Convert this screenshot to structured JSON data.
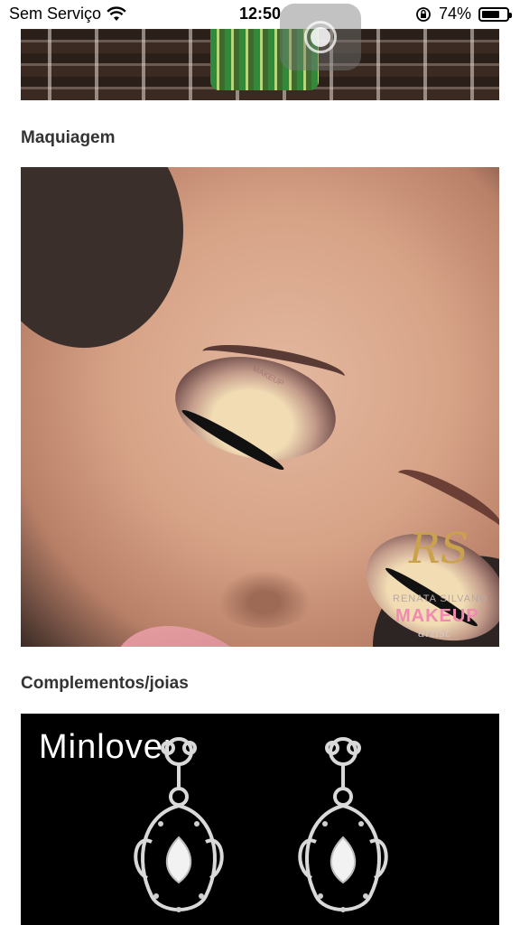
{
  "status_bar": {
    "carrier": "Sem Serviço",
    "time": "12:50",
    "battery_percent": "74%",
    "battery_level": 0.74,
    "icons": [
      "wifi-icon",
      "orientation-lock-icon",
      "battery-icon"
    ]
  },
  "sections": {
    "makeup": {
      "heading": "Maquiagem",
      "watermark": {
        "monogram": "RS",
        "name": "RENATA SILVANO",
        "word": "MAKEUP",
        "tagline": "artist"
      }
    },
    "jewelry": {
      "heading": "Complementos/joias",
      "watermark": "Minlover"
    }
  }
}
